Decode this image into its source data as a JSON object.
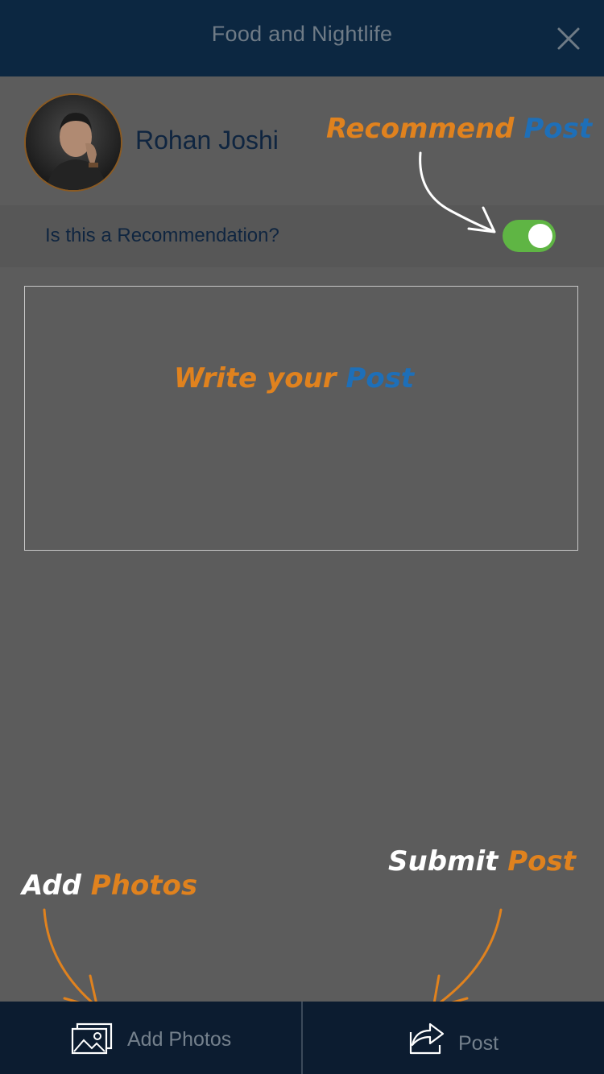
{
  "header": {
    "title": "Food and Nightlife",
    "close_icon": "close-icon"
  },
  "profile": {
    "name": "Rohan Joshi",
    "avatar_icon": "avatar-photo"
  },
  "recommendation": {
    "label": "Is this a Recommendation?",
    "toggle_on": true
  },
  "annotations": {
    "recommend": {
      "part1": "Recommend",
      "part2": "Post"
    },
    "write": {
      "part1": "Write your",
      "part2": "Post"
    },
    "add_photos": {
      "part1": "Add",
      "part2": "Photos"
    },
    "submit": {
      "part1": "Submit",
      "part2": "Post"
    }
  },
  "footer": {
    "add_photos_label": "Add Photos",
    "post_label": "Post",
    "add_photos_icon": "photos-icon",
    "post_icon": "share-icon"
  },
  "colors": {
    "header_bg": "#0c2741",
    "body_bg": "#5c5c5c",
    "toggle_on": "#5fb544",
    "annotation_orange": "#e0821e",
    "annotation_blue": "#1e6fb8",
    "footer_bg": "#0c1c30"
  }
}
